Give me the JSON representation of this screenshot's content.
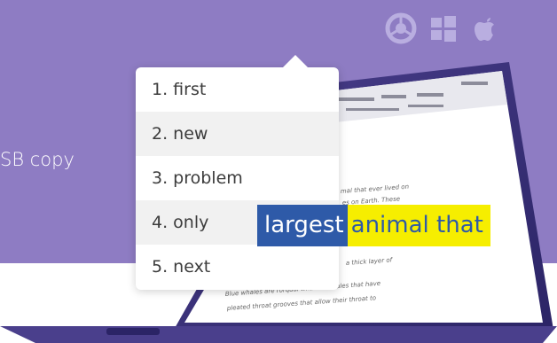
{
  "banner": {
    "color": "#8e7cc3",
    "side_text": "SB copy"
  },
  "os_icons": [
    "chrome-icon",
    "windows-icon",
    "apple-icon"
  ],
  "suggestions": {
    "items": [
      "1. first",
      "2. new",
      "3. problem",
      "4. only",
      "5. next"
    ]
  },
  "highlight": {
    "selected_word": "largest",
    "following_text": "animal that",
    "selected_color": "#2e5aa8",
    "following_color": "#f6ee00"
  },
  "document": {
    "lines": [
      "mal that ever lived on",
      "es on Earth. These",
      "a thick layer of",
      "Blue whales are rorqual whales. Whales that have",
      "pleated throat grooves that allow their throat to"
    ]
  }
}
